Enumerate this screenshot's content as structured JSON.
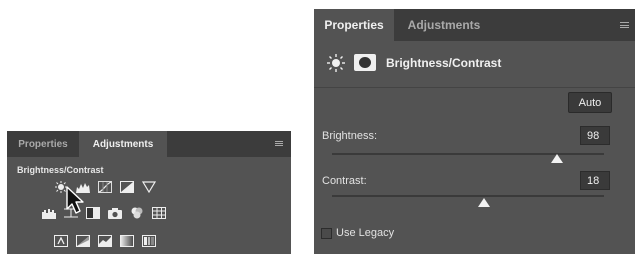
{
  "left_panel": {
    "tabs": [
      "Properties",
      "Adjustments"
    ],
    "active_tab": "Adjustments",
    "section_title": "Brightness/Contrast",
    "menu_icon": "panel-menu-icon",
    "icon_rows": [
      [
        "brightness-contrast-icon",
        "levels-icon",
        "curves-icon",
        "exposure-icon",
        "vibrance-icon"
      ],
      [
        "hue-saturation-icon",
        "color-balance-icon",
        "black-white-icon",
        "photo-filter-icon",
        "channel-mixer-icon",
        "color-lookup-icon"
      ],
      [
        "invert-icon",
        "posterize-icon",
        "threshold-icon",
        "gradient-map-icon",
        "selective-color-icon"
      ]
    ],
    "cursor": "arrow-cursor-icon"
  },
  "right_panel": {
    "tabs": [
      "Properties",
      "Adjustments"
    ],
    "active_tab": "Properties",
    "menu_icon": "panel-menu-icon",
    "header_title": "Brightness/Contrast",
    "auto_label": "Auto",
    "brightness": {
      "label": "Brightness:",
      "value": "98"
    },
    "contrast": {
      "label": "Contrast:",
      "value": "18"
    },
    "brightness_level": 98,
    "contrast_level": 18,
    "slider_range": [
      -150,
      150
    ],
    "legacy_label": "Use Legacy",
    "legacy_checked": false
  },
  "colors": {
    "panel_bg": "#535353",
    "tab_bar": "#3c3c3c",
    "text": "#dcdcdc"
  }
}
